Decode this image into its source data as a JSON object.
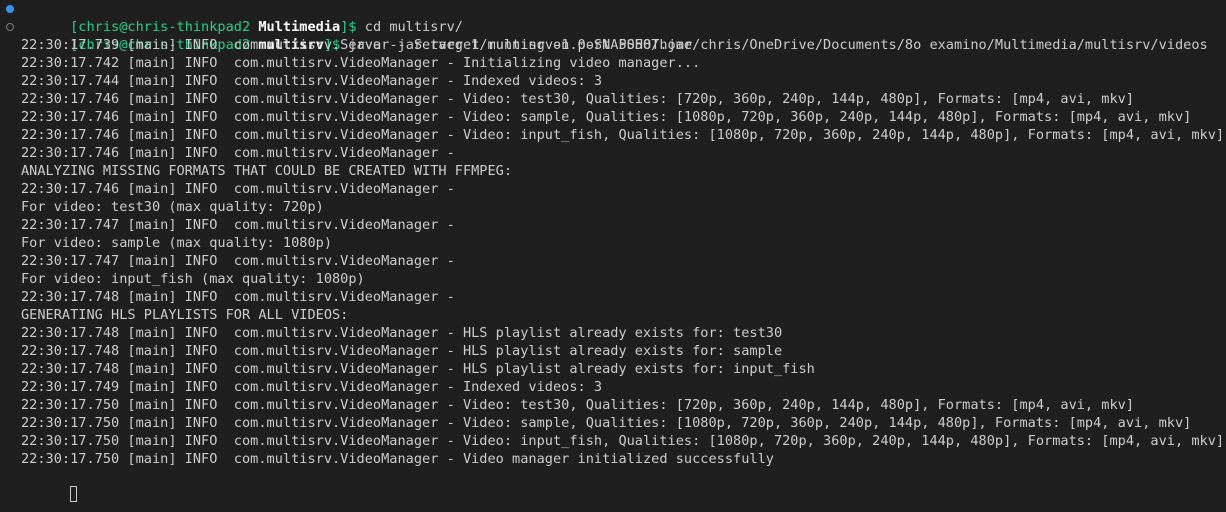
{
  "terminal": {
    "colors": {
      "background": "#1f1f1f",
      "foreground": "#cccccc",
      "prompt_green": "#23d18b",
      "decoration_success": "#3794ff"
    },
    "prompts": [
      {
        "decoration": "success",
        "open": "[",
        "user_host": "chris@chris-thinkpad2",
        "cwd": "Multimedia",
        "close": "]$",
        "command": "cd multisrv/"
      },
      {
        "decoration": "neutral",
        "open": "[",
        "user_host": "chris@chris-thinkpad2",
        "cwd": "multisrv",
        "close": "]$",
        "command": "java -jar target/multisrv-1.0-SNAPSHOT.jar"
      }
    ],
    "output": [
      "22:30:17.739 [main] INFO  com.multisrv.Server - Server 1 running on port 5058/home/chris/OneDrive/Documents/8o examino/Multimedia/multisrv/videos",
      "22:30:17.742 [main] INFO  com.multisrv.VideoManager - Initializing video manager...",
      "22:30:17.744 [main] INFO  com.multisrv.VideoManager - Indexed videos: 3",
      "22:30:17.746 [main] INFO  com.multisrv.VideoManager - Video: test30, Qualities: [720p, 360p, 240p, 144p, 480p], Formats: [mp4, avi, mkv]",
      "22:30:17.746 [main] INFO  com.multisrv.VideoManager - Video: sample, Qualities: [1080p, 720p, 360p, 240p, 144p, 480p], Formats: [mp4, avi, mkv]",
      "22:30:17.746 [main] INFO  com.multisrv.VideoManager - Video: input_fish, Qualities: [1080p, 720p, 360p, 240p, 144p, 480p], Formats: [mp4, avi, mkv]",
      "22:30:17.746 [main] INFO  com.multisrv.VideoManager - ",
      "ANALYZING MISSING FORMATS THAT COULD BE CREATED WITH FFMPEG:",
      "22:30:17.746 [main] INFO  com.multisrv.VideoManager - ",
      "For video: test30 (max quality: 720p)",
      "22:30:17.747 [main] INFO  com.multisrv.VideoManager - ",
      "For video: sample (max quality: 1080p)",
      "22:30:17.747 [main] INFO  com.multisrv.VideoManager - ",
      "For video: input_fish (max quality: 1080p)",
      "22:30:17.748 [main] INFO  com.multisrv.VideoManager - ",
      "GENERATING HLS PLAYLISTS FOR ALL VIDEOS:",
      "22:30:17.748 [main] INFO  com.multisrv.VideoManager - HLS playlist already exists for: test30",
      "22:30:17.748 [main] INFO  com.multisrv.VideoManager - HLS playlist already exists for: sample",
      "22:30:17.748 [main] INFO  com.multisrv.VideoManager - HLS playlist already exists for: input_fish",
      "22:30:17.749 [main] INFO  com.multisrv.VideoManager - Indexed videos: 3",
      "22:30:17.750 [main] INFO  com.multisrv.VideoManager - Video: test30, Qualities: [720p, 360p, 240p, 144p, 480p], Formats: [mp4, avi, mkv]",
      "22:30:17.750 [main] INFO  com.multisrv.VideoManager - Video: sample, Qualities: [1080p, 720p, 360p, 240p, 144p, 480p], Formats: [mp4, avi, mkv]",
      "22:30:17.750 [main] INFO  com.multisrv.VideoManager - Video: input_fish, Qualities: [1080p, 720p, 360p, 240p, 144p, 480p], Formats: [mp4, avi, mkv]",
      "22:30:17.750 [main] INFO  com.multisrv.VideoManager - Video manager initialized successfully"
    ]
  }
}
